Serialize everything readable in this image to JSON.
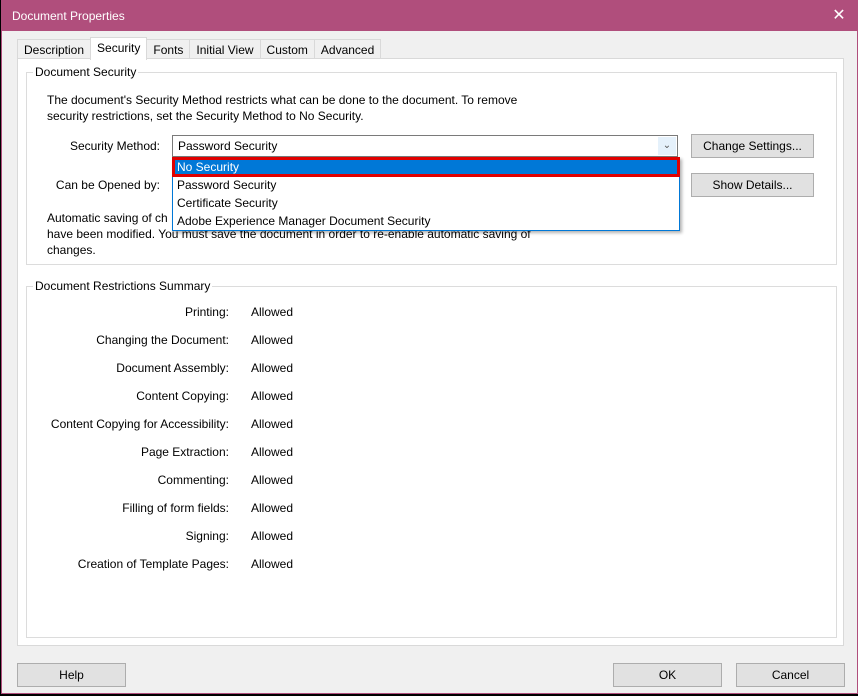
{
  "window": {
    "title": "Document Properties",
    "close_icon": "close-icon",
    "accent_color": "#b04e7c"
  },
  "tabs": [
    {
      "label": "Description",
      "active": false
    },
    {
      "label": "Security",
      "active": true
    },
    {
      "label": "Fonts",
      "active": false
    },
    {
      "label": "Initial View",
      "active": false
    },
    {
      "label": "Custom",
      "active": false
    },
    {
      "label": "Advanced",
      "active": false
    }
  ],
  "document_security": {
    "group_label": "Document Security",
    "description": "The document's Security Method restricts what can be done to the document. To remove security restrictions, set the Security Method to No Security.",
    "security_method_label": "Security Method:",
    "security_method_value": "Password Security",
    "dropdown_options": [
      {
        "label": "No Security",
        "highlighted": true
      },
      {
        "label": "Password Security",
        "highlighted": false
      },
      {
        "label": "Certificate Security",
        "highlighted": false
      },
      {
        "label": "Adobe Experience Manager Document Security",
        "highlighted": false
      }
    ],
    "can_be_opened_label": "Can be Opened by:",
    "change_settings_label": "Change Settings...",
    "show_details_label": "Show Details...",
    "auto_save_note_line1": "Automatic saving of ch",
    "auto_save_note_line2": "have been modified. You must save the document in order to re-enable automatic saving of",
    "auto_save_note_line3": "changes."
  },
  "restrictions": {
    "group_label": "Document Restrictions Summary",
    "rows": [
      {
        "label": "Printing:",
        "value": "Allowed"
      },
      {
        "label": "Changing the Document:",
        "value": "Allowed"
      },
      {
        "label": "Document Assembly:",
        "value": "Allowed"
      },
      {
        "label": "Content Copying:",
        "value": "Allowed"
      },
      {
        "label": "Content Copying for Accessibility:",
        "value": "Allowed"
      },
      {
        "label": "Page Extraction:",
        "value": "Allowed"
      },
      {
        "label": "Commenting:",
        "value": "Allowed"
      },
      {
        "label": "Filling of form fields:",
        "value": "Allowed"
      },
      {
        "label": "Signing:",
        "value": "Allowed"
      },
      {
        "label": "Creation of Template Pages:",
        "value": "Allowed"
      }
    ]
  },
  "footer": {
    "help_label": "Help",
    "ok_label": "OK",
    "cancel_label": "Cancel"
  }
}
